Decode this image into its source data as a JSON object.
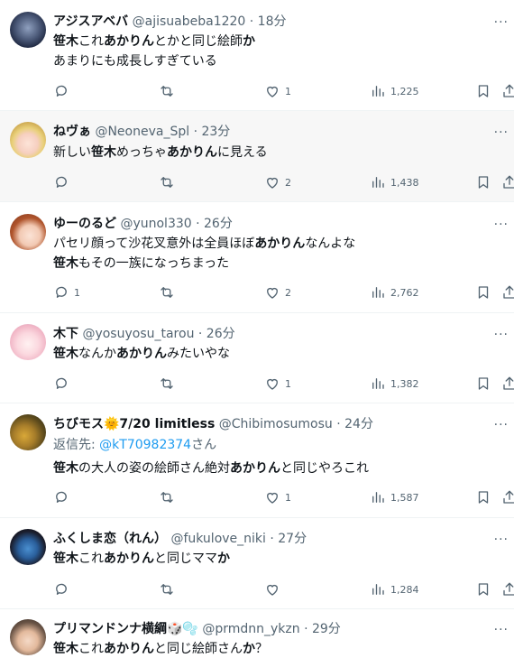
{
  "more_glyph": "···",
  "replying_to_prefix": "返信先: ",
  "tweets": [
    {
      "name": "アジスアベバ",
      "handle": "@ajisuabeba1220",
      "time": "· 18分",
      "lines": [
        [
          [
            "笹木",
            "b"
          ],
          [
            "これ",
            ""
          ],
          [
            "あかりん",
            "b"
          ],
          [
            "とかと同じ絵師",
            ""
          ],
          [
            "か",
            "b"
          ]
        ],
        [
          [
            "あまりにも成長しすぎている",
            ""
          ]
        ]
      ],
      "replies": "",
      "retweets": "",
      "likes": "1",
      "views": "1,225"
    },
    {
      "name": "ねヴぁ",
      "handle": "@Neoneva_Spl",
      "time": "· 23分",
      "lines": [
        [
          [
            "新しい",
            ""
          ],
          [
            "笹木",
            "b"
          ],
          [
            "めっちゃ",
            ""
          ],
          [
            "あかりん",
            "b"
          ],
          [
            "に見える",
            ""
          ]
        ]
      ],
      "replies": "",
      "retweets": "",
      "likes": "2",
      "views": "1,438"
    },
    {
      "name": "ゆーのるど",
      "handle": "@yunol330",
      "time": "· 26分",
      "lines": [
        [
          [
            "パセリ顔って沙花叉意外は全員ほぼ",
            ""
          ],
          [
            "あかりん",
            "b"
          ],
          [
            "なんよな",
            ""
          ]
        ],
        [
          [
            "笹木",
            "b"
          ],
          [
            "もその一族になっちまった",
            ""
          ]
        ]
      ],
      "replies": "1",
      "retweets": "",
      "likes": "2",
      "views": "2,762"
    },
    {
      "name": "木下",
      "handle": "@yosuyosu_tarou",
      "time": "· 26分",
      "lines": [
        [
          [
            "笹木",
            "b"
          ],
          [
            "なんか",
            ""
          ],
          [
            "あかりん",
            "b"
          ],
          [
            "みたいやな",
            ""
          ]
        ]
      ],
      "replies": "",
      "retweets": "",
      "likes": "1",
      "views": "1,382"
    },
    {
      "name": "ちびモス🌞7/20 limitless",
      "handle": "@Chibimosumosu",
      "time": "· 24分",
      "reply_to": "@kT70982374",
      "reply_suffix": "さん",
      "lines": [
        [
          [
            "笹木",
            "b"
          ],
          [
            "の大人の姿の絵師さん絶対",
            ""
          ],
          [
            "あかりん",
            "b"
          ],
          [
            "と同じやろこれ",
            ""
          ]
        ]
      ],
      "replies": "",
      "retweets": "",
      "likes": "1",
      "views": "1,587"
    },
    {
      "name": "ふくしま恋（れん）",
      "handle": "@fukulove_niki",
      "time": "· 27分",
      "lines": [
        [
          [
            "笹木",
            "b"
          ],
          [
            "これ",
            ""
          ],
          [
            "あかりん",
            "b"
          ],
          [
            "と同じママ",
            ""
          ],
          [
            "か",
            "b"
          ]
        ]
      ],
      "replies": "",
      "retweets": "",
      "likes": "",
      "views": "1,284"
    },
    {
      "name": "プリマンドンナ横綱🎲🫧",
      "handle": "@prmdnn_ykzn",
      "time": "· 29分",
      "lines": [
        [
          [
            "笹木",
            "b"
          ],
          [
            "これ",
            ""
          ],
          [
            "あかりん",
            "b"
          ],
          [
            "と同じ絵師さん",
            ""
          ],
          [
            "か",
            "b"
          ],
          [
            "？",
            ""
          ]
        ]
      ],
      "replies": "",
      "retweets": "",
      "likes": "",
      "views": ""
    }
  ]
}
